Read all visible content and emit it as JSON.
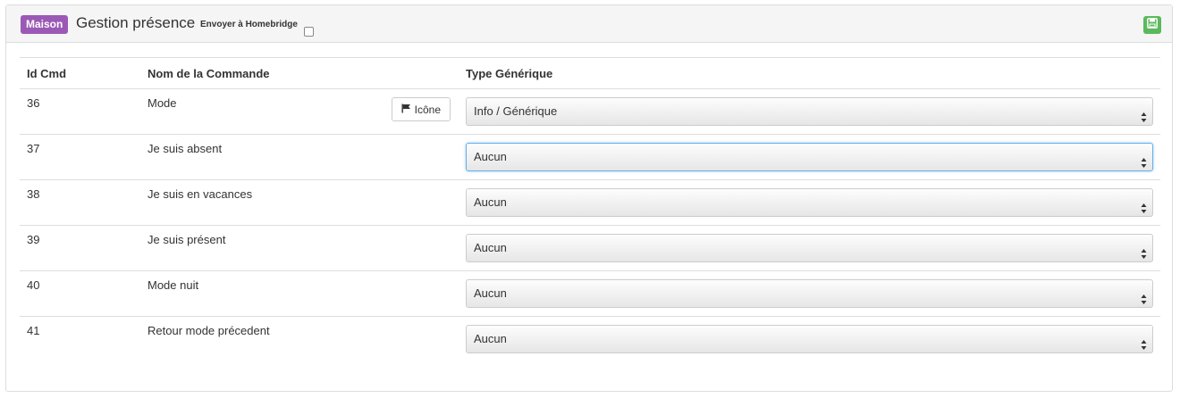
{
  "header": {
    "badge": "Maison",
    "title": "Gestion présence",
    "homebridge_label": "Envoyer à Homebridge",
    "homebridge_checked": false,
    "save_icon": "floppy-disk-icon",
    "accent_color": "#9b59b6",
    "save_color": "#5cb85c"
  },
  "table": {
    "columns": [
      "Id Cmd",
      "Nom de la Commande",
      "Type Générique"
    ],
    "icon_button_label": "Icône",
    "icon_button_icon": "flag-icon",
    "rows": [
      {
        "id": "36",
        "name": "Mode",
        "type": "Info / Générique",
        "has_icon_button": true
      },
      {
        "id": "37",
        "name": "Je suis absent",
        "type": "Aucun",
        "focused": true
      },
      {
        "id": "38",
        "name": "Je suis en vacances",
        "type": "Aucun"
      },
      {
        "id": "39",
        "name": "Je suis présent",
        "type": "Aucun"
      },
      {
        "id": "40",
        "name": "Mode nuit",
        "type": "Aucun"
      },
      {
        "id": "41",
        "name": "Retour mode précedent",
        "type": "Aucun"
      }
    ]
  }
}
